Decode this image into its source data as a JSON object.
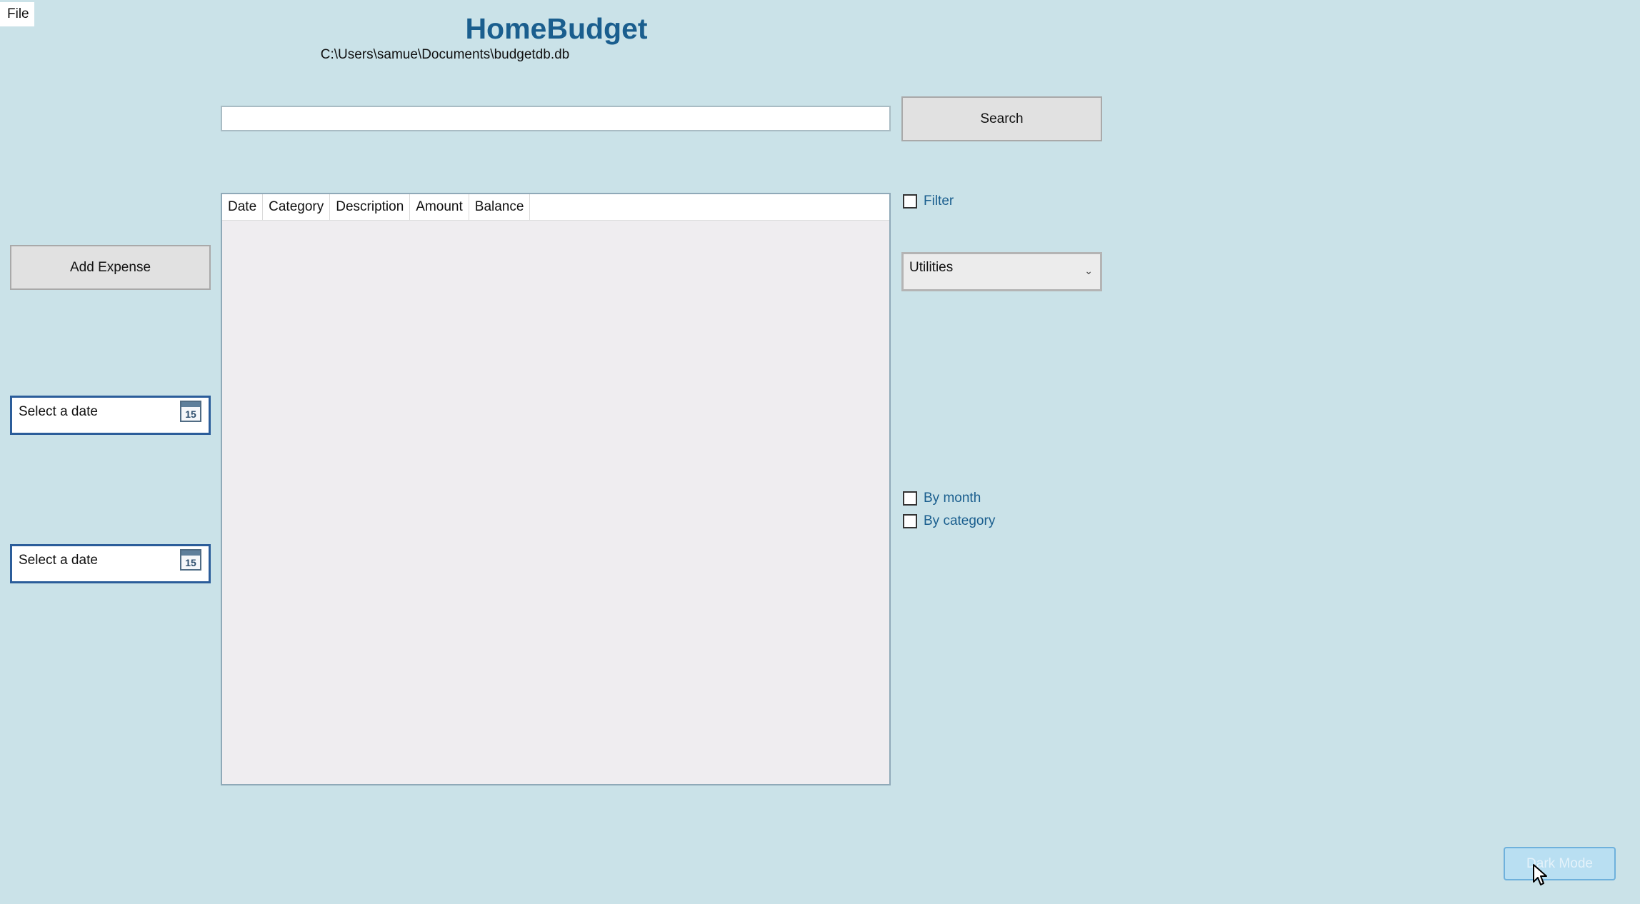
{
  "menu": {
    "file_label": "File"
  },
  "app": {
    "title": "HomeBudget",
    "db_path": "C:\\Users\\samue\\Documents\\budgetdb.db"
  },
  "search": {
    "value": "",
    "button_label": "Search"
  },
  "actions": {
    "add_expense_label": "Add Expense",
    "dark_mode_label": "Dark Mode"
  },
  "date_pickers": {
    "start_placeholder": "Select a date",
    "end_placeholder": "Select a date",
    "calendar_icon_number": "15"
  },
  "grid": {
    "columns": [
      "Date",
      "Category",
      "Description",
      "Amount",
      "Balance"
    ],
    "rows": []
  },
  "filters": {
    "filter_label": "Filter",
    "filter_checked": false,
    "category_selected": "Utilities",
    "by_month_label": "By month",
    "by_month_checked": false,
    "by_category_label": "By category",
    "by_category_checked": false
  },
  "colors": {
    "background": "#cae2e8",
    "title": "#1a5e8e",
    "date_picker_border": "#2b5d9a",
    "dark_mode_button": "#b9dff2"
  }
}
